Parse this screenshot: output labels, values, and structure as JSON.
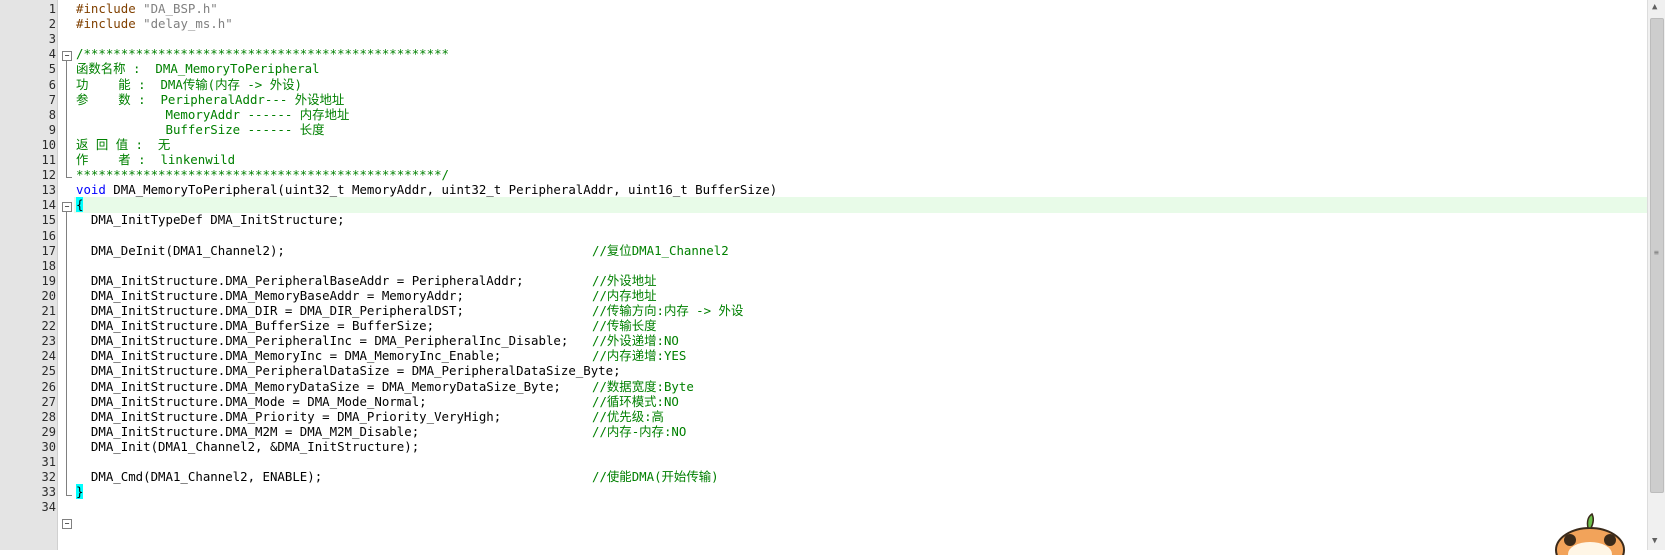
{
  "editor": {
    "current_line": 14,
    "lines": [
      {
        "n": "1",
        "text": "#include \"DA_BSP.h\"",
        "kind": "pre"
      },
      {
        "n": "2",
        "text": "#include \"delay_ms.h\"",
        "kind": "pre"
      },
      {
        "n": "3",
        "text": "",
        "kind": "plain"
      },
      {
        "n": "4",
        "text": "/*************************************************",
        "kind": "comment"
      },
      {
        "n": "5",
        "text": "函数名称 :  DMA_MemoryToPeripheral",
        "kind": "comment"
      },
      {
        "n": "6",
        "text": "功    能 :  DMA传输(内存 -> 外设)",
        "kind": "comment"
      },
      {
        "n": "7",
        "text": "参    数 :  PeripheralAddr--- 外设地址",
        "kind": "comment"
      },
      {
        "n": "8",
        "text": "            MemoryAddr ------ 内存地址",
        "kind": "comment"
      },
      {
        "n": "9",
        "text": "            BufferSize ------ 长度",
        "kind": "comment"
      },
      {
        "n": "10",
        "text": "返 回 值 :  无",
        "kind": "comment"
      },
      {
        "n": "11",
        "text": "作    者 :  linkenwild",
        "kind": "comment"
      },
      {
        "n": "12",
        "text": "*************************************************/",
        "kind": "comment"
      },
      {
        "n": "13",
        "text": "DMA_MemoryToPeripheral(uint32_t MemoryAddr, uint32_t PeripheralAddr, uint16_t BufferSize)",
        "kind": "func",
        "kw": "void"
      },
      {
        "n": "14",
        "text": "{",
        "kind": "brace"
      },
      {
        "n": "15",
        "text": "  DMA_InitTypeDef DMA_InitStructure;",
        "kind": "plain"
      },
      {
        "n": "16",
        "text": "",
        "kind": "plain"
      },
      {
        "n": "17",
        "text": "  DMA_DeInit(DMA1_Channel2);",
        "kind": "plain",
        "comment": "//复位DMA1_Channel2"
      },
      {
        "n": "18",
        "text": "",
        "kind": "plain"
      },
      {
        "n": "19",
        "text": "  DMA_InitStructure.DMA_PeripheralBaseAddr = PeripheralAddr;",
        "kind": "plain",
        "comment": "//外设地址"
      },
      {
        "n": "20",
        "text": "  DMA_InitStructure.DMA_MemoryBaseAddr = MemoryAddr;",
        "kind": "plain",
        "comment": "//内存地址"
      },
      {
        "n": "21",
        "text": "  DMA_InitStructure.DMA_DIR = DMA_DIR_PeripheralDST;",
        "kind": "plain",
        "comment": "//传输方向:内存 -> 外设"
      },
      {
        "n": "22",
        "text": "  DMA_InitStructure.DMA_BufferSize = BufferSize;",
        "kind": "plain",
        "comment": "//传输长度"
      },
      {
        "n": "23",
        "text": "  DMA_InitStructure.DMA_PeripheralInc = DMA_PeripheralInc_Disable;",
        "kind": "plain",
        "comment": "//外设递增:NO"
      },
      {
        "n": "24",
        "text": "  DMA_InitStructure.DMA_MemoryInc = DMA_MemoryInc_Enable;",
        "kind": "plain",
        "comment": "//内存递增:YES"
      },
      {
        "n": "25",
        "text": "  DMA_InitStructure.DMA_PeripheralDataSize = DMA_PeripheralDataSize_Byte;",
        "kind": "plain"
      },
      {
        "n": "26",
        "text": "  DMA_InitStructure.DMA_MemoryDataSize = DMA_MemoryDataSize_Byte;",
        "kind": "plain",
        "comment": "//数据宽度:Byte"
      },
      {
        "n": "27",
        "text": "  DMA_InitStructure.DMA_Mode = DMA_Mode_Normal;",
        "kind": "plain",
        "comment": "//循环模式:NO"
      },
      {
        "n": "28",
        "text": "  DMA_InitStructure.DMA_Priority = DMA_Priority_VeryHigh;",
        "kind": "plain",
        "comment": "//优先级:高"
      },
      {
        "n": "29",
        "text": "  DMA_InitStructure.DMA_M2M = DMA_M2M_Disable;",
        "kind": "plain",
        "comment": "//内存-内存:NO"
      },
      {
        "n": "30",
        "text": "  DMA_Init(DMA1_Channel2, &DMA_InitStructure);",
        "kind": "plain"
      },
      {
        "n": "31",
        "text": "",
        "kind": "plain"
      },
      {
        "n": "32",
        "text": "  DMA_Cmd(DMA1_Channel2, ENABLE);",
        "kind": "plain",
        "comment": "//使能DMA(开始传输)"
      },
      {
        "n": "33",
        "text": "}",
        "kind": "brace"
      },
      {
        "n": "34",
        "text": "",
        "kind": "plain"
      }
    ]
  },
  "colors": {
    "preprocessor": "#804000",
    "string": "#808080",
    "comment": "#008000",
    "keyword": "#0000ff",
    "current_line_bg": "#e8fbe8",
    "brace_highlight": "#00ffff"
  },
  "icons": {
    "fold_open": "fold-minus-icon",
    "scroll_grip": "grip-icon",
    "mascot": "cat-sticker-icon"
  }
}
